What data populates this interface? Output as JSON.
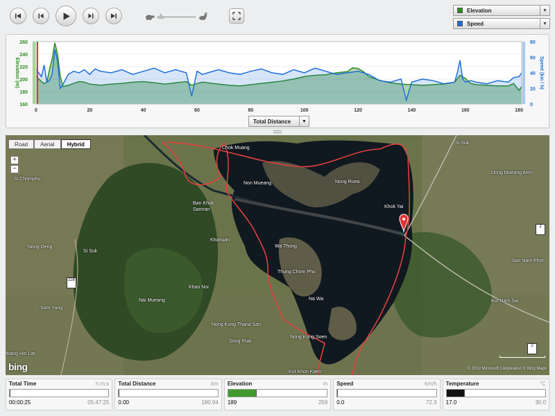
{
  "playback": {
    "buttons": [
      "skip-to-start",
      "step-back",
      "play",
      "step-forward",
      "skip-to-end"
    ],
    "speed_slider_level": 0.05
  },
  "series_selectors": {
    "primary": {
      "label": "Elevation",
      "color": "#2e8b22"
    },
    "secondary": {
      "label": "Speed",
      "color": "#1e6fd9"
    }
  },
  "chart_data": {
    "type": "area",
    "xlabel": "Total Distance",
    "x_ticks": [
      "0",
      "20",
      "40",
      "60",
      "80",
      "100",
      "120",
      "140",
      "160",
      "180"
    ],
    "xlim": [
      0,
      181
    ],
    "left_axis": {
      "label": "Elevation (m)",
      "ticks": [
        "160",
        "180",
        "200",
        "220",
        "240",
        "260"
      ],
      "range": [
        160,
        260
      ],
      "color": "#2e8b22"
    },
    "right_axis": {
      "label": "Speed (km / h)",
      "ticks": [
        "0",
        "20",
        "40",
        "60",
        "80"
      ],
      "range": [
        0,
        80
      ],
      "color": "#1e6fd9"
    },
    "cursor_x": 0,
    "series": [
      {
        "name": "Elevation",
        "axis": "left",
        "color": "#2e8b22",
        "x": [
          0,
          1,
          2,
          3,
          4,
          5,
          6,
          7,
          8,
          9,
          10,
          12,
          14,
          16,
          18,
          20,
          24,
          28,
          32,
          36,
          40,
          44,
          48,
          52,
          56,
          58,
          60,
          62,
          64,
          68,
          72,
          76,
          80,
          84,
          88,
          92,
          96,
          100,
          104,
          108,
          112,
          116,
          118,
          120,
          122,
          124,
          128,
          132,
          136,
          140,
          144,
          148,
          152,
          156,
          158,
          160,
          162,
          164,
          168,
          172,
          176,
          178,
          180,
          181
        ],
        "y": [
          205,
          200,
          196,
          193,
          195,
          215,
          232,
          258,
          240,
          205,
          188,
          190,
          193,
          196,
          195,
          192,
          190,
          192,
          193,
          195,
          196,
          194,
          192,
          194,
          196,
          190,
          193,
          195,
          194,
          192,
          190,
          189,
          191,
          193,
          195,
          197,
          200,
          204,
          206,
          207,
          210,
          212,
          218,
          217,
          212,
          204,
          198,
          194,
          192,
          191,
          190,
          191,
          192,
          195,
          206,
          201,
          193,
          191,
          190,
          189,
          189,
          193,
          182,
          188
        ]
      },
      {
        "name": "Speed",
        "axis": "right",
        "color": "#1e6fd9",
        "x": [
          0,
          1,
          2,
          3,
          4,
          5,
          6,
          7,
          8,
          9,
          10,
          12,
          14,
          16,
          18,
          20,
          22,
          24,
          28,
          32,
          36,
          40,
          44,
          48,
          52,
          56,
          58,
          60,
          62,
          64,
          68,
          72,
          76,
          80,
          84,
          88,
          92,
          96,
          100,
          104,
          108,
          112,
          116,
          120,
          124,
          128,
          132,
          136,
          138,
          140,
          144,
          148,
          152,
          156,
          157,
          158,
          159,
          160,
          162,
          164,
          168,
          172,
          176,
          178,
          180,
          181
        ],
        "y": [
          45,
          40,
          35,
          50,
          28,
          30,
          38,
          70,
          55,
          20,
          25,
          38,
          42,
          40,
          44,
          38,
          45,
          42,
          40,
          44,
          38,
          42,
          46,
          40,
          44,
          40,
          10,
          42,
          38,
          40,
          44,
          40,
          38,
          42,
          45,
          40,
          38,
          44,
          40,
          46,
          42,
          38,
          40,
          42,
          38,
          30,
          28,
          32,
          5,
          28,
          32,
          30,
          26,
          28,
          40,
          56,
          32,
          28,
          30,
          28,
          26,
          30,
          28,
          34,
          35,
          40
        ]
      }
    ]
  },
  "xaxis_selector": {
    "label": "Total Distance"
  },
  "map": {
    "types": [
      "Road",
      "Aerial",
      "Hybrid"
    ],
    "active_type": "Hybrid",
    "zoom_in": "+",
    "zoom_out": "−",
    "labels": [
      "Chok Muang",
      "Non Mueang",
      "Nong Ruea",
      "Khok Yai",
      "Si Chomphu",
      "Ban Khok Samran",
      "Khanuan",
      "Wa Thong",
      "Nong Deng",
      "Si Suk",
      "Thung Chom Phu",
      "Khao Noi",
      "Na Wa",
      "Nai Mueang",
      "Sam Yang",
      "Nong Kung Thana San",
      "Song Puai",
      "Nong Kung Soen",
      "Kut Khon Kaen",
      "Wang Hin Lat",
      "Si Suk",
      "Dong Mueang Aem",
      "San Nam Phot",
      "Kut Nam Sai"
    ],
    "route_badges": [
      "228",
      "2",
      "2"
    ],
    "logo": "bing",
    "copyright": "© 2010 Microsoft Corporation  © Bing Maps"
  },
  "stats": [
    {
      "name": "Total Time",
      "unit": "h:m:s",
      "current": "00:00:25",
      "max": "05:47:25",
      "fill": 0,
      "fill_color": "#6aa84f"
    },
    {
      "name": "Total Distance",
      "unit": "km",
      "current": "0.00",
      "max": "180.94",
      "fill": 0,
      "fill_color": "#6aa84f"
    },
    {
      "name": "Elevation",
      "unit": "m",
      "current": "189",
      "max": "259",
      "fill": 0.28,
      "fill_color": "#3f9a2b"
    },
    {
      "name": "Speed",
      "unit": "km/h",
      "current": "0.0",
      "max": "72.3",
      "fill": 0,
      "fill_color": "#6aa84f"
    },
    {
      "name": "Temperature",
      "unit": "°C",
      "current": "17.0",
      "max": "30.0",
      "fill": 0.18,
      "fill_color": "#111111"
    }
  ]
}
